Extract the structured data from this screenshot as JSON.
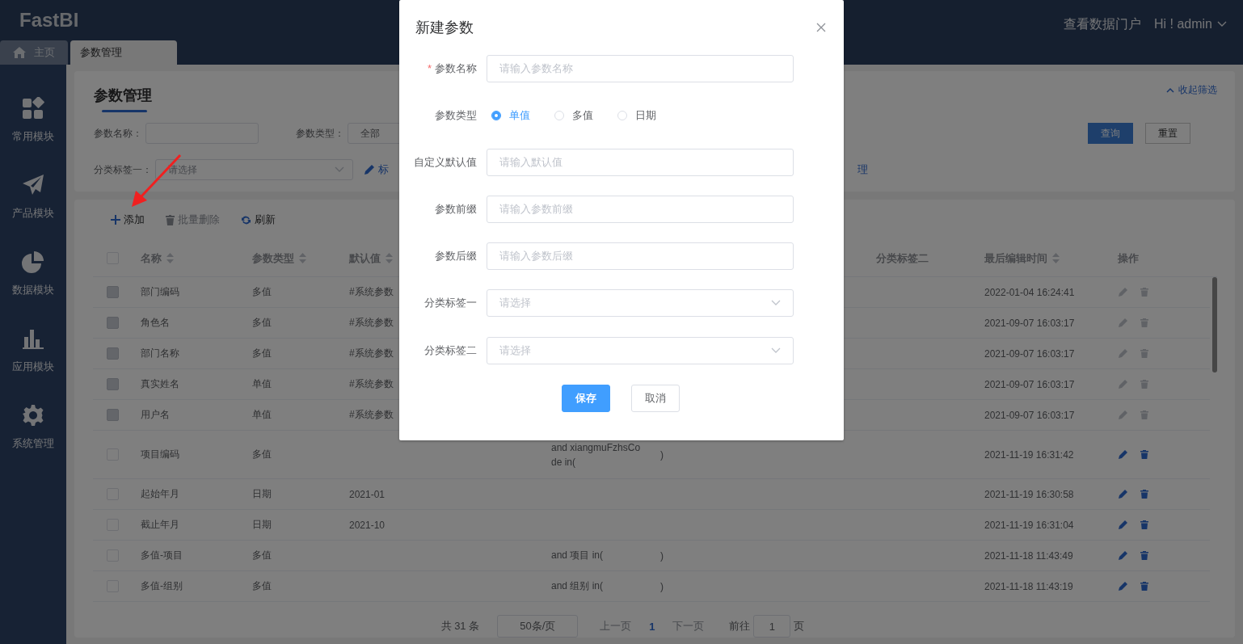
{
  "header": {
    "logo": "FastBI",
    "portal_link": "查看数据门户",
    "user": "Hi ! admin"
  },
  "tabs": [
    {
      "label": "主页",
      "selected": false
    },
    {
      "label": "参数管理",
      "selected": true
    }
  ],
  "sidebar": {
    "items": [
      {
        "label": "常用模块"
      },
      {
        "label": "产品模块"
      },
      {
        "label": "数据模块"
      },
      {
        "label": "应用模块"
      },
      {
        "label": "系统管理"
      }
    ]
  },
  "filter": {
    "title": "参数管理",
    "collapse": "收起筛选",
    "name_label": "参数名称：",
    "type_label": "参数类型：",
    "type_value": "全部",
    "tag1_label": "分类标签一：",
    "tag1_placeholder": "请选择",
    "tag_link_left": "标",
    "tag_link_right": "理",
    "buttons": [
      {
        "label": "查询",
        "kind": "primary"
      },
      {
        "label": "重置",
        "kind": "default"
      }
    ]
  },
  "toolbar": [
    {
      "label": "添加",
      "kind": "add",
      "disabled": false
    },
    {
      "label": "批量删除",
      "kind": "delete",
      "disabled": true
    },
    {
      "label": "刷新",
      "kind": "refresh",
      "disabled": false
    }
  ],
  "table": {
    "select_all": {
      "checked": false
    },
    "columns": [
      {
        "label": "名称",
        "sortable": true
      },
      {
        "label": "参数类型",
        "sortable": true
      },
      {
        "label": "默认值",
        "sortable": true
      },
      {
        "label": "分类标签二",
        "sortable": false
      },
      {
        "label": "最后编辑时间",
        "sortable": true
      },
      {
        "label": "操作",
        "sortable": false
      }
    ],
    "rows": [
      {
        "name": "部门编码",
        "type": "多值",
        "default": "#系统参数",
        "time": "2022-01-04 16:24:41",
        "disabled": true
      },
      {
        "name": "角色名",
        "type": "多值",
        "default": "#系统参数",
        "time": "2021-09-07 16:03:17",
        "disabled": true
      },
      {
        "name": "部门名称",
        "type": "多值",
        "default": "#系统参数",
        "time": "2021-09-07 16:03:17",
        "disabled": true
      },
      {
        "name": "真实姓名",
        "type": "单值",
        "default": "#系统参数",
        "time": "2021-09-07 16:03:17",
        "disabled": true
      },
      {
        "name": "用户名",
        "type": "单值",
        "default": "#系统参数",
        "time": "2021-09-07 16:03:17",
        "disabled": true
      },
      {
        "name": "项目编码",
        "type": "多值",
        "column_4": [
          "and xiangmuFzhsCo",
          "de in("
        ],
        "column_5": ")",
        "time": "2021-11-19 16:31:42",
        "disabled": false
      },
      {
        "name": "起始年月",
        "type": "日期",
        "default": "2021-01",
        "time": "2021-11-19 16:30:58",
        "disabled": false
      },
      {
        "name": "截止年月",
        "type": "日期",
        "default": "2021-10",
        "time": "2021-11-19 16:31:04",
        "disabled": false
      },
      {
        "name": "多值-项目",
        "type": "多值",
        "column_4": [
          "and 项目 in("
        ],
        "column_5": ")",
        "time": "2021-11-18 11:43:49",
        "disabled": false
      },
      {
        "name": "多值-组别",
        "type": "多值",
        "column_4": [
          "and 组别 in("
        ],
        "column_5": ")",
        "time": "2021-11-18 11:43:19",
        "disabled": false
      }
    ]
  },
  "pagination": {
    "total": "共 31 条",
    "page_size": "50条/页",
    "prev": {
      "label": "上一页",
      "disabled": true
    },
    "pages": [
      {
        "label": "1",
        "selected": true
      }
    ],
    "next": {
      "label": "下一页",
      "disabled": true
    },
    "goto_label": "前往",
    "goto_value": "1",
    "goto_suffix": "页"
  },
  "dialog": {
    "title": "新建参数",
    "fields": [
      {
        "label": "参数名称",
        "kind": "input",
        "required_mark": "*",
        "placeholder": "请输入参数名称"
      },
      {
        "label": "参数类型",
        "kind": "radio",
        "options": [
          {
            "label": "单值",
            "selected": true
          },
          {
            "label": "多值",
            "selected": false
          },
          {
            "label": "日期",
            "selected": false
          }
        ]
      },
      {
        "label": "自定义默认值",
        "kind": "input",
        "placeholder": "请输入默认值"
      },
      {
        "label": "参数前缀",
        "kind": "input",
        "placeholder": "请输入参数前缀"
      },
      {
        "label": "参数后缀",
        "kind": "input",
        "placeholder": "请输入参数后缀"
      },
      {
        "label": "分类标签一",
        "kind": "select",
        "placeholder": "请选择"
      },
      {
        "label": "分类标签二",
        "kind": "select",
        "placeholder": "请选择"
      }
    ],
    "buttons": [
      {
        "label": "保存",
        "kind": "primary"
      },
      {
        "label": "取消",
        "kind": "default"
      }
    ]
  }
}
